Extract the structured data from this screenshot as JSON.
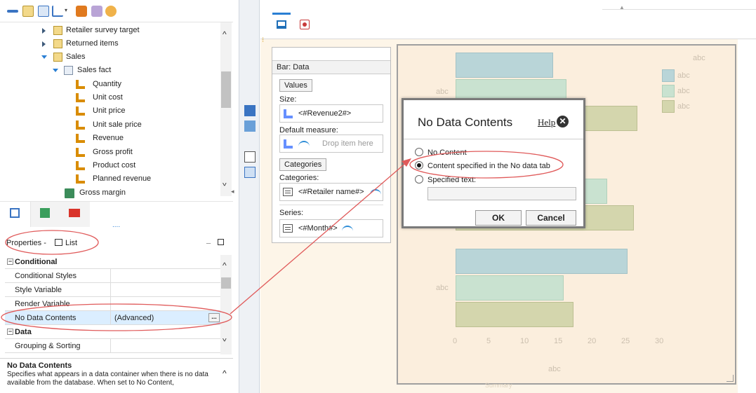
{
  "tree": {
    "items": [
      {
        "label": "Retailer survey target",
        "kind": "folder",
        "expander": "right"
      },
      {
        "label": "Returned items",
        "kind": "folder",
        "expander": "right"
      },
      {
        "label": "Sales",
        "kind": "folder",
        "expander": "down"
      },
      {
        "label": "Sales fact",
        "kind": "fact",
        "expander": "down"
      },
      {
        "label": "Quantity",
        "kind": "measure"
      },
      {
        "label": "Unit cost",
        "kind": "measure"
      },
      {
        "label": "Unit price",
        "kind": "measure"
      },
      {
        "label": "Unit sale price",
        "kind": "measure"
      },
      {
        "label": "Revenue",
        "kind": "measure"
      },
      {
        "label": "Gross profit",
        "kind": "measure"
      },
      {
        "label": "Product cost",
        "kind": "measure"
      },
      {
        "label": "Planned revenue",
        "kind": "measure"
      },
      {
        "label": "Gross margin",
        "kind": "calc"
      }
    ]
  },
  "panel_tabs": {
    "ellipsis": "....",
    "icons": [
      "structure-icon",
      "data-items-icon",
      "toolbox-icon"
    ]
  },
  "properties": {
    "header": "Properties -",
    "object": "List",
    "minimize": "_",
    "rows": [
      {
        "name": "Conditional",
        "value": "",
        "category": true
      },
      {
        "name": "Conditional Styles",
        "value": ""
      },
      {
        "name": "Style Variable",
        "value": ""
      },
      {
        "name": "Render Variable",
        "value": ""
      },
      {
        "name": "No Data Contents",
        "value": "(Advanced)",
        "selected": true
      },
      {
        "name": "Data",
        "value": "",
        "category": true
      },
      {
        "name": "Grouping & Sorting",
        "value": ""
      }
    ],
    "ellipsis_button": "..."
  },
  "help": {
    "title": "No Data Contents",
    "text": "Specifies what appears in a data container when there is no data available from the database. When set to No Content,"
  },
  "data_panel": {
    "header": "Bar: Data",
    "values_button": "Values",
    "size_label": "Size:",
    "size_item": "<#Revenue2#>",
    "default_measure_label": "Default measure:",
    "drop_placeholder": "Drop item here",
    "categories_button": "Categories",
    "categories_label": "Categories:",
    "categories_item": "<#Retailer name#>",
    "series_label": "Series:",
    "series_item": "<#Month#>"
  },
  "dialog": {
    "title": "No Data Contents",
    "help": "Help",
    "close": "✕",
    "options": [
      {
        "label": "No Content",
        "checked": false
      },
      {
        "label": "Content specified in the No data tab",
        "checked": true
      },
      {
        "label": "Specified text:",
        "checked": false
      }
    ],
    "ok": "OK",
    "cancel": "Cancel"
  },
  "chart_data": {
    "type": "bar",
    "orientation": "horizontal",
    "categories": [
      "abc",
      "abc",
      "abc"
    ],
    "series": [
      {
        "name": "abc",
        "values": [
          14.5,
          16.5,
          25.5
        ],
        "color": "#b9d5d8"
      },
      {
        "name": "abc",
        "values": [
          16.5,
          22.5,
          16
        ]
      },
      {
        "name": "abc",
        "values": [
          27,
          26.5,
          17.5
        ],
        "color": "#d4d6ad"
      }
    ],
    "x_ticks": [
      "0",
      "5",
      "10",
      "15",
      "20",
      "25",
      "30"
    ],
    "xlabel": "abc",
    "ylim": [
      0,
      30
    ],
    "legend": [
      "abc",
      "abc",
      "abc"
    ],
    "axis_title_top": "abc",
    "footer_label": "Summary"
  },
  "colors": {
    "accent": "#2a7fd4",
    "annotation": "#e05a5a"
  }
}
